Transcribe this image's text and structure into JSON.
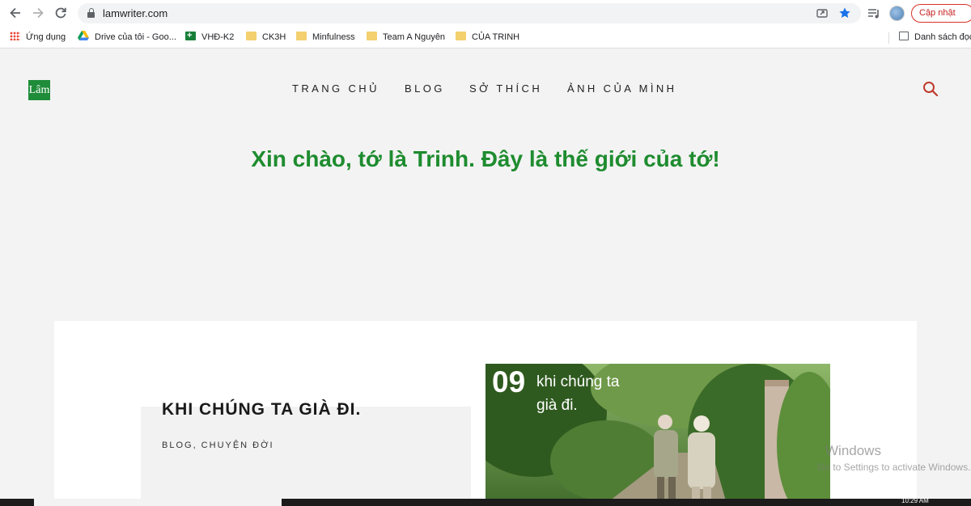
{
  "browser": {
    "url": "lamwriter.com",
    "update_button": "Cập nhật",
    "bookmarks": [
      {
        "label": "Ứng dụng",
        "icon": "apps-grid-icon"
      },
      {
        "label": "Drive của tôi - Goo...",
        "icon": "google-drive-icon"
      },
      {
        "label": "VHĐ-K2",
        "icon": "google-sheets-icon"
      },
      {
        "label": "CK3H",
        "icon": "folder-icon"
      },
      {
        "label": "Minfulness",
        "icon": "folder-icon"
      },
      {
        "label": "Team A Nguyên",
        "icon": "folder-icon"
      },
      {
        "label": "CỦA TRINH",
        "icon": "folder-icon"
      }
    ],
    "reading_list": "Danh sách đọc"
  },
  "site": {
    "logo": "Lâm",
    "menu": [
      "TRANG CHỦ",
      "BLOG",
      "SỞ THÍCH",
      "ẢNH CỦA MÌNH"
    ],
    "tagline": "Xin chào, tớ là Trinh. Đây là thế giới của tớ!",
    "accent_color": "#1e8c2f"
  },
  "post": {
    "title": "KHI CHÚNG TA GIÀ ĐI.",
    "categories": "BLOG, CHUYỆN ĐỜI",
    "image_number": "09",
    "image_caption": "khi chúng ta già đi."
  },
  "os": {
    "watermark_title": "Windows",
    "watermark_sub": "Go to Settings to activate Windows.",
    "clock": "10:29 AM"
  }
}
